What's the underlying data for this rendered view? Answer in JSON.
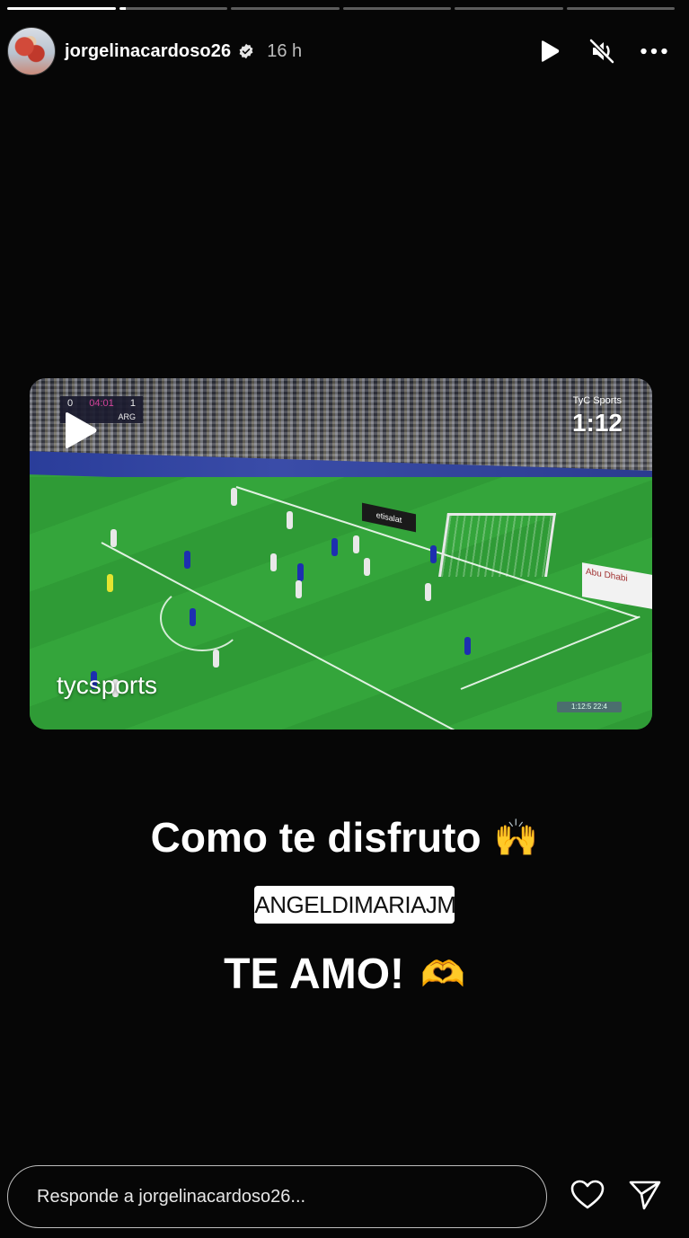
{
  "story": {
    "segments_total": 6,
    "active_segment": 1,
    "username": "jorgelinacardoso26",
    "verified": true,
    "time_ago": "16 h"
  },
  "video": {
    "duration": "1:12",
    "watermark": "tycsports",
    "broadcaster": "TyC Sports",
    "score_home": "0",
    "score_away": "1",
    "score_away_team": "ARG",
    "replay_tag": "1:12:5 22:4"
  },
  "captions": {
    "line1": "Como te disfruto",
    "line1_emoji": "🙌",
    "mention": "ANGELDIMARIAJM",
    "line2": "TE AMO!",
    "line2_emoji": "🫶"
  },
  "reply": {
    "placeholder": "Responde a jorgelinacardoso26..."
  },
  "icons": {
    "play": "play-icon",
    "mute": "muted-speaker-icon",
    "more": "more-options-icon",
    "like": "heart-icon",
    "send": "send-icon"
  }
}
